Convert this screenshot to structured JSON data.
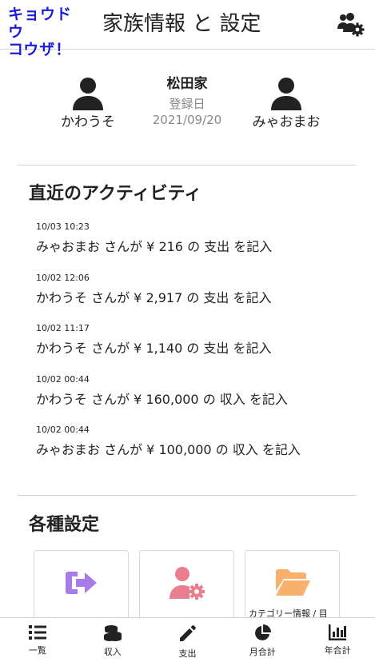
{
  "header": {
    "logo_line1": "キョウドウ",
    "logo_line2": "コウザ！",
    "title": "家族情報 と 設定",
    "family_settings_icon": "users-gear-icon"
  },
  "family": {
    "name": "松田家",
    "registered_label": "登録日",
    "registered_date": "2021/09/20",
    "members": [
      {
        "name": "かわうそ",
        "icon": "user-icon"
      },
      {
        "name": "みゃおまお",
        "icon": "user-icon"
      }
    ]
  },
  "activity": {
    "title": "直近のアクティビティ",
    "items": [
      {
        "time": "10/03 10:23",
        "text": "みゃおまお さんが ¥ 216 の 支出 を記入"
      },
      {
        "time": "10/02 12:06",
        "text": "かわうそ さんが ¥ 2,917 の 支出 を記入"
      },
      {
        "time": "10/02 11:17",
        "text": "かわうそ さんが ¥ 1,140 の 支出 を記入"
      },
      {
        "time": "10/02 00:44",
        "text": "かわうそ さんが ¥ 160,000 の 収入 を記入"
      },
      {
        "time": "10/02 00:44",
        "text": "みゃおまお さんが ¥ 100,000 の 収入 を記入"
      }
    ]
  },
  "settings": {
    "title": "各種設定",
    "cards": [
      {
        "icon": "sign-out-icon",
        "label": "",
        "color": "#a77be8"
      },
      {
        "icon": "user-gear-icon",
        "label": "",
        "color": "#e97e8e"
      },
      {
        "icon": "folder-open-icon",
        "label": "カテゴリー情報 / 目",
        "color": "#f8b16d"
      }
    ]
  },
  "nav": {
    "items": [
      {
        "label": "一覧",
        "icon": "list-icon"
      },
      {
        "label": "収入",
        "icon": "coins-icon"
      },
      {
        "label": "支出",
        "icon": "pencil-icon"
      },
      {
        "label": "月合計",
        "icon": "pie-chart-icon"
      },
      {
        "label": "年合計",
        "icon": "bar-chart-icon"
      }
    ]
  },
  "colors": {
    "logo": "#1b1bd9",
    "text": "#222222",
    "muted": "#888888",
    "divider": "#cfcfcf"
  }
}
